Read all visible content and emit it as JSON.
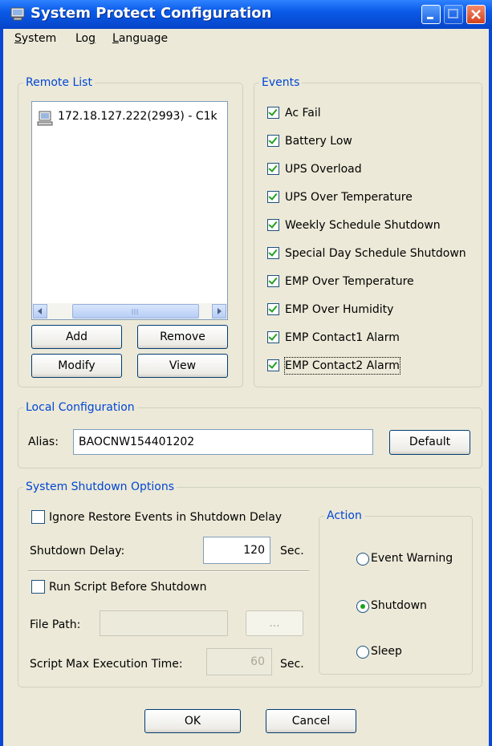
{
  "window": {
    "title": "System Protect Configuration"
  },
  "menu": [
    {
      "label": "System",
      "u": "S",
      "rest": "ystem"
    },
    {
      "label": "Log",
      "pre": "Lo",
      "u": "g"
    },
    {
      "label": "Language",
      "u": "L",
      "rest": "anguage"
    }
  ],
  "remote_list": {
    "label": "Remote List",
    "items": [
      "172.18.127.222(2993) - C1k"
    ],
    "buttons": {
      "add": "Add",
      "remove": "Remove",
      "modify": "Modify",
      "view": "View"
    }
  },
  "events": {
    "label": "Events",
    "items": [
      {
        "label": "Ac Fail",
        "checked": true
      },
      {
        "label": "Battery Low",
        "checked": true
      },
      {
        "label": "UPS Overload",
        "checked": true
      },
      {
        "label": "UPS Over Temperature",
        "checked": true
      },
      {
        "label": "Weekly Schedule Shutdown",
        "checked": true
      },
      {
        "label": "Special Day Schedule Shutdown",
        "checked": true
      },
      {
        "label": "EMP Over Temperature",
        "checked": true
      },
      {
        "label": "EMP Over Humidity",
        "checked": true
      },
      {
        "label": "EMP Contact1 Alarm",
        "checked": true
      },
      {
        "label": "EMP Contact2 Alarm",
        "checked": true
      }
    ]
  },
  "local_config": {
    "label": "Local Configuration",
    "alias_label": "Alias:",
    "alias_value": "BAOCNW154401202",
    "default_button": "Default"
  },
  "shutdown": {
    "label": "System Shutdown Options",
    "ignore_restore_label": "Ignore Restore Events in Shutdown Delay",
    "ignore_restore_checked": false,
    "delay_label": "Shutdown Delay:",
    "delay_value": "120",
    "sec_label": "Sec.",
    "run_script_label": "Run Script Before Shutdown",
    "run_script_checked": false,
    "file_path_label": "File Path:",
    "file_path_value": "",
    "browse_button": "...",
    "max_exec_label": "Script Max Execution Time:",
    "max_exec_value": "60",
    "max_exec_sec": "Sec."
  },
  "action": {
    "label": "Action",
    "options": [
      {
        "label": "Event Warning",
        "selected": false
      },
      {
        "label": "Shutdown",
        "selected": true
      },
      {
        "label": "Sleep",
        "selected": false
      }
    ]
  },
  "footer": {
    "ok": "OK",
    "cancel": "Cancel"
  },
  "colors": {
    "title_blue": "#0a5ae8",
    "group_label": "#0046d5",
    "dialog_bg": "#ece9d8",
    "check_green": "#21a121"
  }
}
